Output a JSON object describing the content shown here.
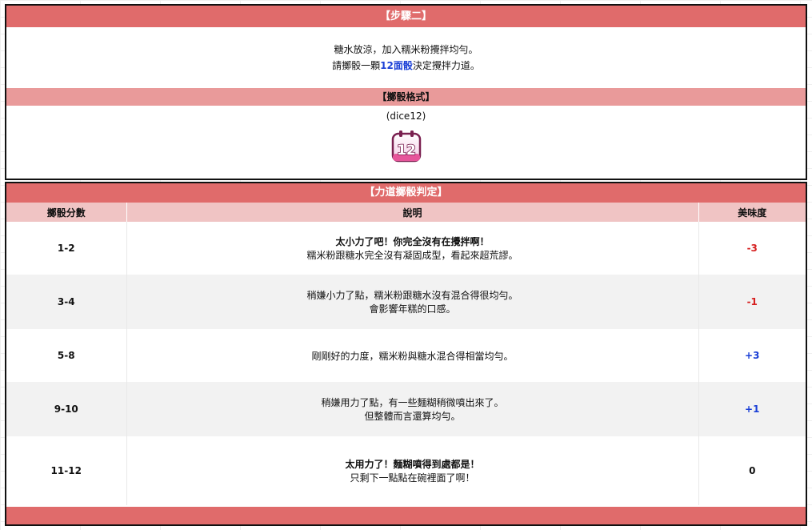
{
  "step": {
    "title": "【步驟二】",
    "intro_line1": "糖水放涼，加入糯米粉攪拌均勻。",
    "intro_line2_pre": "請擲骰一顆",
    "intro_line2_highlight": "12面骰",
    "intro_line2_post": "決定攪拌力道。",
    "format_title": "【擲骰格式】",
    "format_value": "(dice12)",
    "dice_icon_label": "12"
  },
  "judge": {
    "title": "【力道擲骰判定】",
    "headers": [
      "擲骰分數",
      "說明",
      "美味度"
    ],
    "rows": [
      {
        "score": "1-2",
        "line1": "太小力了吧！你完全沒有在攪拌啊！",
        "line2": "糯米粉跟糖水完全沒有凝固成型，看起來超荒謬。",
        "taste": "-3"
      },
      {
        "score": "3-4",
        "line1": "稍嫌小力了點，糯米粉跟糖水沒有混合得很均勻。",
        "line2": "會影響年糕的口感。",
        "taste": "-1"
      },
      {
        "score": "5-8",
        "line1": "剛剛好的力度，糯米粉與糖水混合得相當均勻。",
        "line2": "",
        "taste": "+3"
      },
      {
        "score": "9-10",
        "line1": "稍嫌用力了點，有一些麵糊稍微噴出來了。",
        "line2": "但整體而言還算均勻。",
        "taste": "+1"
      },
      {
        "score": "11-12",
        "line1": "太用力了！麵糊噴得到處都是！",
        "line2": "只剩下一點點在碗裡面了啊！",
        "taste": "0"
      }
    ]
  },
  "colors": {
    "header": "#e06b6b",
    "subheader": "#e99a9a",
    "negative": "#d61f1f",
    "positive": "#1a3fd6"
  }
}
